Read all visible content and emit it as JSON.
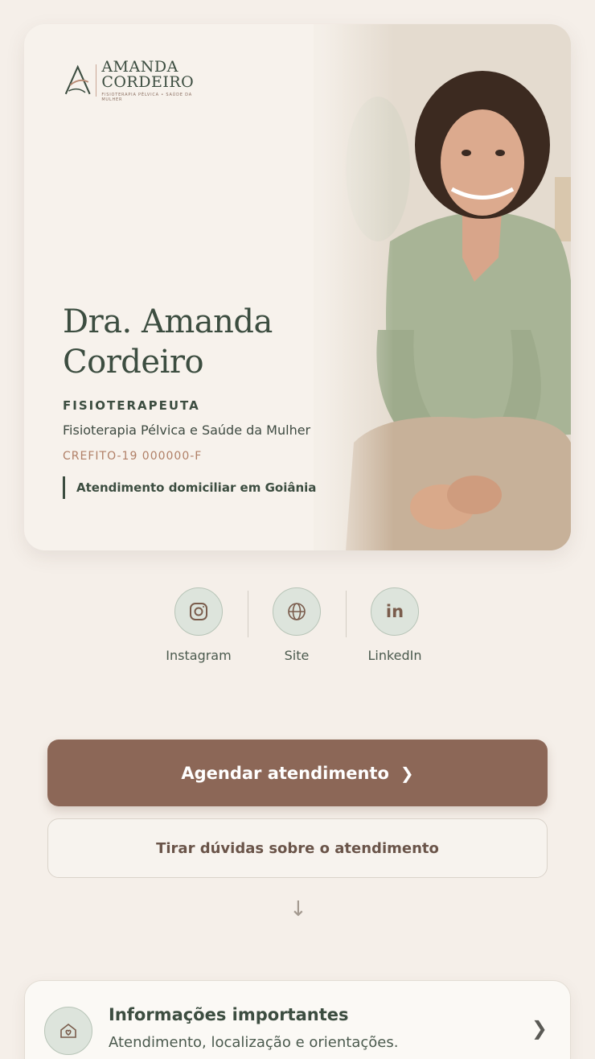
{
  "hero": {
    "logo": {
      "line1": "AMANDA",
      "line2": "CORDEIRO",
      "tagline": "Fisioterapia Pélvica • Saúde da Mulher"
    },
    "name_line1": "Dra. Amanda",
    "name_line2": "Cordeiro",
    "role": "FISIOTERAPEUTA",
    "specialty": "Fisioterapia Pélvica e Saúde da Mulher",
    "crefito": "CREFITO-19 000000-F",
    "home_care": "Atendimento domiciliar em Goiânia"
  },
  "social": [
    {
      "label": "Instagram",
      "icon": "instagram-icon"
    },
    {
      "label": "Site",
      "icon": "globe-icon"
    },
    {
      "label": "LinkedIn",
      "icon": "linkedin-icon"
    }
  ],
  "buttons": {
    "primary": "Agendar atendimento",
    "secondary": "Tirar dúvidas sobre o atendimento"
  },
  "info": {
    "title": "Informações importantes",
    "subtitle": "Atendimento, localização e orientações."
  },
  "colors": {
    "background": "#f5efe9",
    "accent_brown": "#8c6757",
    "text_green": "#3c4d40",
    "crefito": "#b07f66",
    "icon_circle": "#dde4dc"
  }
}
